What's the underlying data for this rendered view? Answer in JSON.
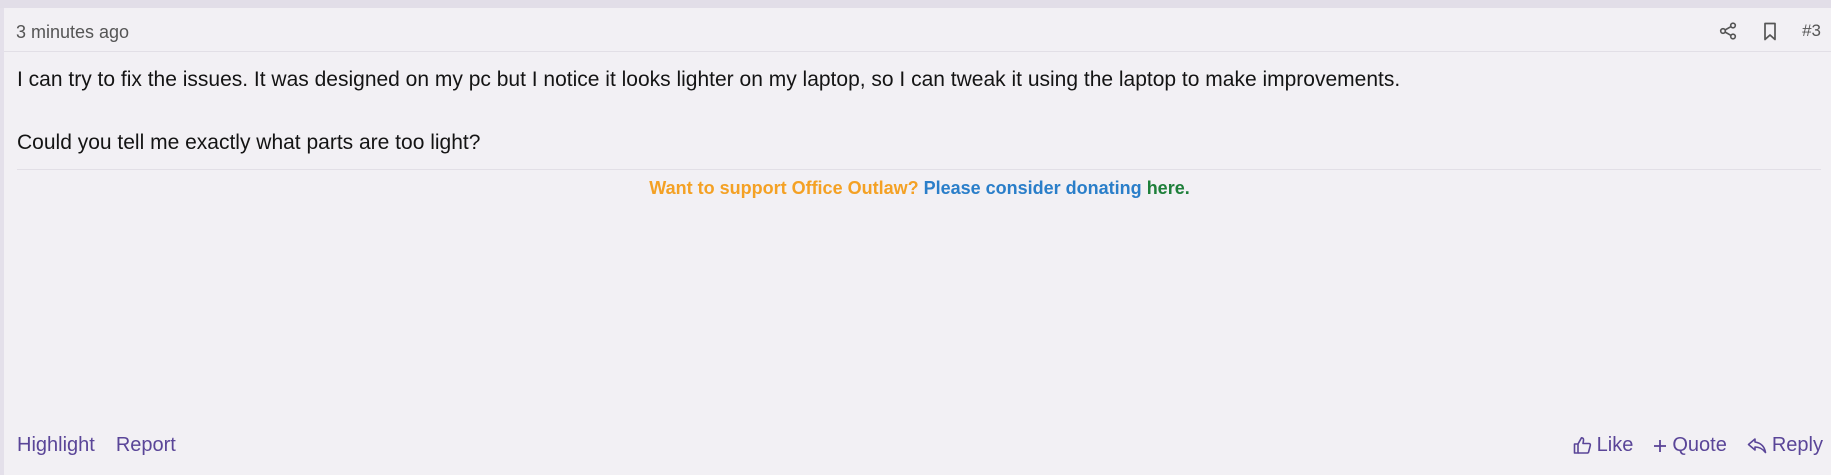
{
  "post": {
    "timestamp": "3 minutes ago",
    "post_number": "#3",
    "paragraphs": [
      "I can try to fix the issues. It was designed on my pc but I notice it looks lighter on my laptop, so I can tweak it using the laptop to make improvements.",
      "Could you tell me exactly what parts are too light?"
    ],
    "icons": {
      "share": "share-icon",
      "bookmark": "bookmark-icon"
    }
  },
  "signature": {
    "part1": "Want to support Office Outlaw?",
    "part2": "Please consider donating",
    "part3": "here.",
    "colors": {
      "orange": "#f4a124",
      "blue": "#2a7ec9",
      "green": "#1e7f3a"
    }
  },
  "footer": {
    "highlight_label": "Highlight",
    "report_label": "Report",
    "like_label": "Like",
    "quote_label": "Quote",
    "reply_label": "Reply",
    "link_color": "#5a4598"
  }
}
